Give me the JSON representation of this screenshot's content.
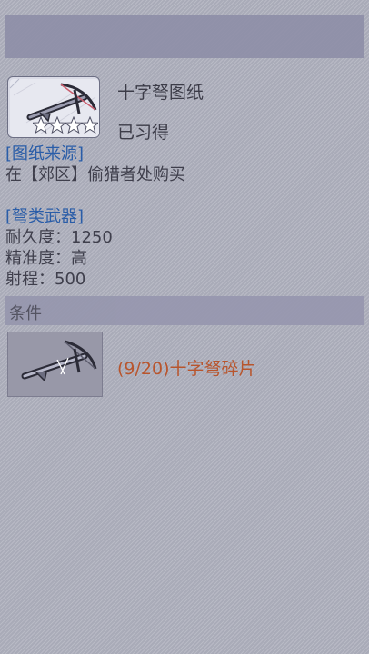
{
  "item": {
    "name": "十字弩图纸",
    "status": "已习得",
    "icon": "crossbow-blueprint-icon",
    "stars": 4
  },
  "source": {
    "tag": "[图纸来源]",
    "text": "在【郊区】偷猎者处购买"
  },
  "weapon": {
    "tag": "[弩类武器]",
    "durability": "耐久度：1250",
    "accuracy": "精准度：高",
    "range": "射程：500"
  },
  "conditions": {
    "header": "条件",
    "items": [
      {
        "icon": "crossbow-fragment-icon",
        "text": "(9/20)十字弩碎片"
      }
    ]
  },
  "colors": {
    "accent_blue": "#2a5da8",
    "progress_orange": "#b8552d",
    "panel_bg": "#a9abb8"
  }
}
